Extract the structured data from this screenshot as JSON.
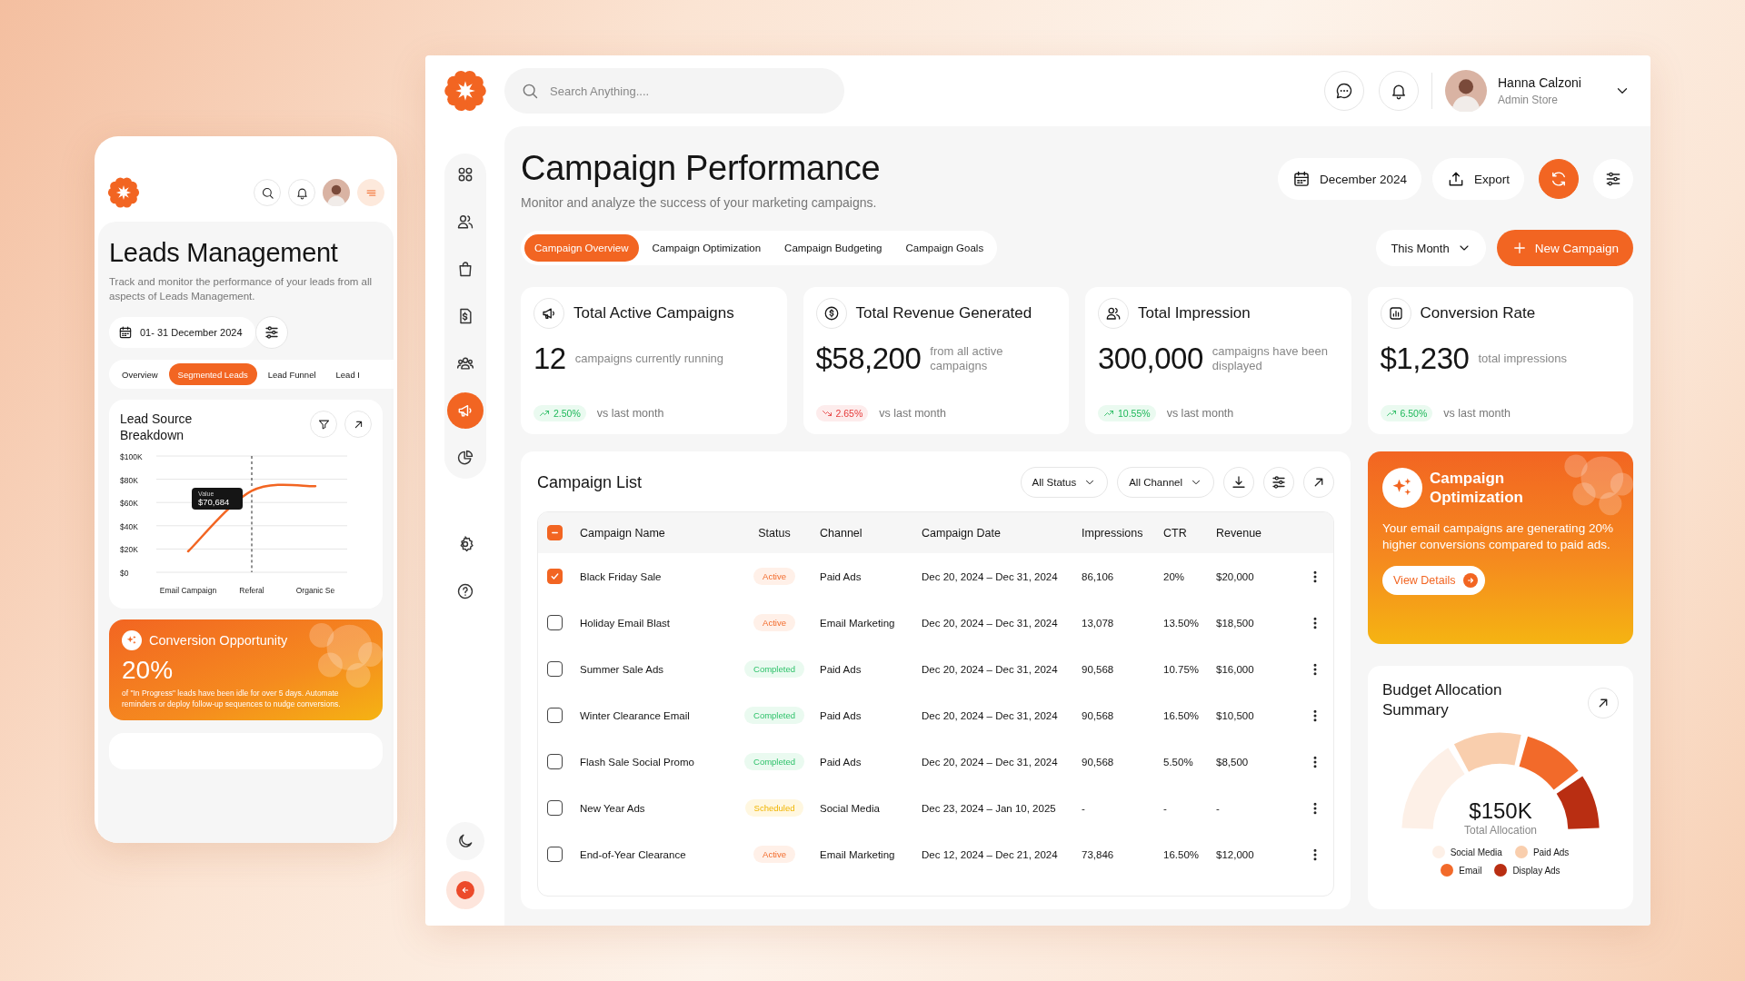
{
  "mobile": {
    "title": "Leads Management",
    "subtitle": "Track and monitor the performance of your leads from all aspects of Leads Management.",
    "date_range": "01- 31 December 2024",
    "tabs": [
      {
        "label": "Overview",
        "selected": false
      },
      {
        "label": "Segmented Leads",
        "selected": true
      },
      {
        "label": "Lead Funnel",
        "selected": false
      },
      {
        "label": "Lead I",
        "selected": false
      }
    ],
    "lead_source": {
      "title": "Lead Source Breakdown",
      "tooltip": {
        "value": "$70,684"
      },
      "chart_data": {
        "type": "line",
        "grid": true,
        "categories": [
          "Email Campaign",
          "Referal",
          "Organic Se"
        ],
        "series": [
          {
            "name": "Value",
            "color": "#f26522",
            "values": [
              18000,
              70000,
              74000
            ]
          }
        ],
        "ylim": [
          0,
          100000
        ],
        "yticks": [
          {
            "value": 0,
            "label": "$0"
          },
          {
            "value": 20000,
            "label": "$20K"
          },
          {
            "value": 40000,
            "label": "$40K"
          },
          {
            "value": 60000,
            "label": "$60K"
          },
          {
            "value": 80000,
            "label": "$80K"
          },
          {
            "value": 100000,
            "label": "$100K"
          }
        ]
      }
    },
    "opportunity": {
      "title": "Conversion Opportunity",
      "value": "20%",
      "text": "of \"In Progress\" leads have been idle for over 5 days. Automate reminders or deploy follow-up sequences to nudge conversions."
    }
  },
  "app": {
    "search": {
      "placeholder": "Search Anything...."
    },
    "user": {
      "name": "Hanna Calzoni",
      "role": "Admin Store"
    },
    "sidebar": {
      "items": [
        {
          "selected": false
        },
        {
          "selected": false
        },
        {
          "selected": false
        },
        {
          "selected": false
        },
        {
          "selected": false
        },
        {
          "selected": true
        },
        {
          "selected": false
        }
      ]
    },
    "page": {
      "title": "Campaign Performance",
      "subtitle": "Monitor and analyze the success of your marketing campaigns.",
      "date_button": "December 2024",
      "export_button": "Export",
      "tabs": [
        {
          "label": "Campaign Overview",
          "selected": true
        },
        {
          "label": "Campaign Optimization",
          "selected": false
        },
        {
          "label": "Campaign Budgeting",
          "selected": false
        },
        {
          "label": "Campaign Goals",
          "selected": false
        }
      ],
      "period": "This Month",
      "new_button": "New Campaign"
    },
    "stats": [
      {
        "title": "Total Active Campaigns",
        "value": "12",
        "description": "campaigns currently running",
        "change": "2.50%",
        "kind": "up",
        "comparison": "vs last month"
      },
      {
        "title": "Total Revenue Generated",
        "value": "$58,200",
        "description": "from all active campaigns",
        "change": "2.65%",
        "kind": "down",
        "comparison": "vs last month"
      },
      {
        "title": "Total Impression",
        "value": "300,000",
        "description": "campaigns have been displayed",
        "change": "10.55%",
        "kind": "up",
        "comparison": "vs last month"
      },
      {
        "title": "Conversion Rate",
        "value": "$1,230",
        "description": "total impressions",
        "change": "6.50%",
        "kind": "up",
        "comparison": "vs last month"
      }
    ],
    "campaign_list": {
      "title": "Campaign List",
      "filters": [
        "All Status",
        "All Channel"
      ],
      "select_all": {
        "checked": true,
        "indeterminate": true
      },
      "columns": [
        "Campaign Name",
        "Status",
        "Channel",
        "Campaign Date",
        "Impressions",
        "CTR",
        "Revenue"
      ],
      "rows": [
        {
          "checked": true,
          "name": "Black Friday Sale",
          "status": "Active",
          "kind": "active",
          "channel": "Paid Ads",
          "date": "Dec 20, 2024 – Dec 31, 2024",
          "impressions": "86,106",
          "ctr": "20%",
          "revenue": "$20,000"
        },
        {
          "checked": false,
          "name": "Holiday Email Blast",
          "status": "Active",
          "kind": "active",
          "channel": "Email Marketing",
          "date": "Dec 20, 2024 – Dec 31, 2024",
          "impressions": "13,078",
          "ctr": "13.50%",
          "revenue": "$18,500"
        },
        {
          "checked": false,
          "name": "Summer Sale Ads",
          "status": "Completed",
          "kind": "completed",
          "channel": "Paid Ads",
          "date": "Dec 20, 2024 – Dec 31, 2024",
          "impressions": "90,568",
          "ctr": "10.75%",
          "revenue": "$16,000"
        },
        {
          "checked": false,
          "name": "Winter Clearance Email",
          "status": "Completed",
          "kind": "completed",
          "channel": "Paid Ads",
          "date": "Dec 20, 2024 – Dec 31, 2024",
          "impressions": "90,568",
          "ctr": "16.50%",
          "revenue": "$10,500"
        },
        {
          "checked": false,
          "name": "Flash Sale Social Promo",
          "status": "Completed",
          "kind": "completed",
          "channel": "Paid Ads",
          "date": "Dec 20, 2024 – Dec 31, 2024",
          "impressions": "90,568",
          "ctr": "5.50%",
          "revenue": "$8,500"
        },
        {
          "checked": false,
          "name": "New Year Ads",
          "status": "Scheduled",
          "kind": "scheduled",
          "channel": "Social Media",
          "date": "Dec 23, 2024 – Jan 10, 2025",
          "impressions": "-",
          "ctr": "-",
          "revenue": "-"
        },
        {
          "checked": false,
          "name": "End-of-Year Clearance",
          "status": "Active",
          "kind": "active",
          "channel": "Email Marketing",
          "date": "Dec 12, 2024 – Dec 21, 2024",
          "impressions": "73,846",
          "ctr": "16.50%",
          "revenue": "$12,000"
        }
      ]
    },
    "optimization": {
      "title": "Campaign Optimization",
      "text": "Your email campaigns are generating 20% higher conversions compared to paid ads.",
      "button": "View Details"
    },
    "budget": {
      "title": "Budget Allocation Summary",
      "total": "$150K",
      "total_label": "Total Allocation",
      "legend": [
        {
          "label": "Social Media",
          "color": "#fdf0e7"
        },
        {
          "label": "Paid Ads",
          "color": "#f9cead"
        },
        {
          "label": "Email",
          "color": "#f26a2a"
        },
        {
          "label": "Display Ads",
          "color": "#b92e12"
        }
      ]
    }
  }
}
